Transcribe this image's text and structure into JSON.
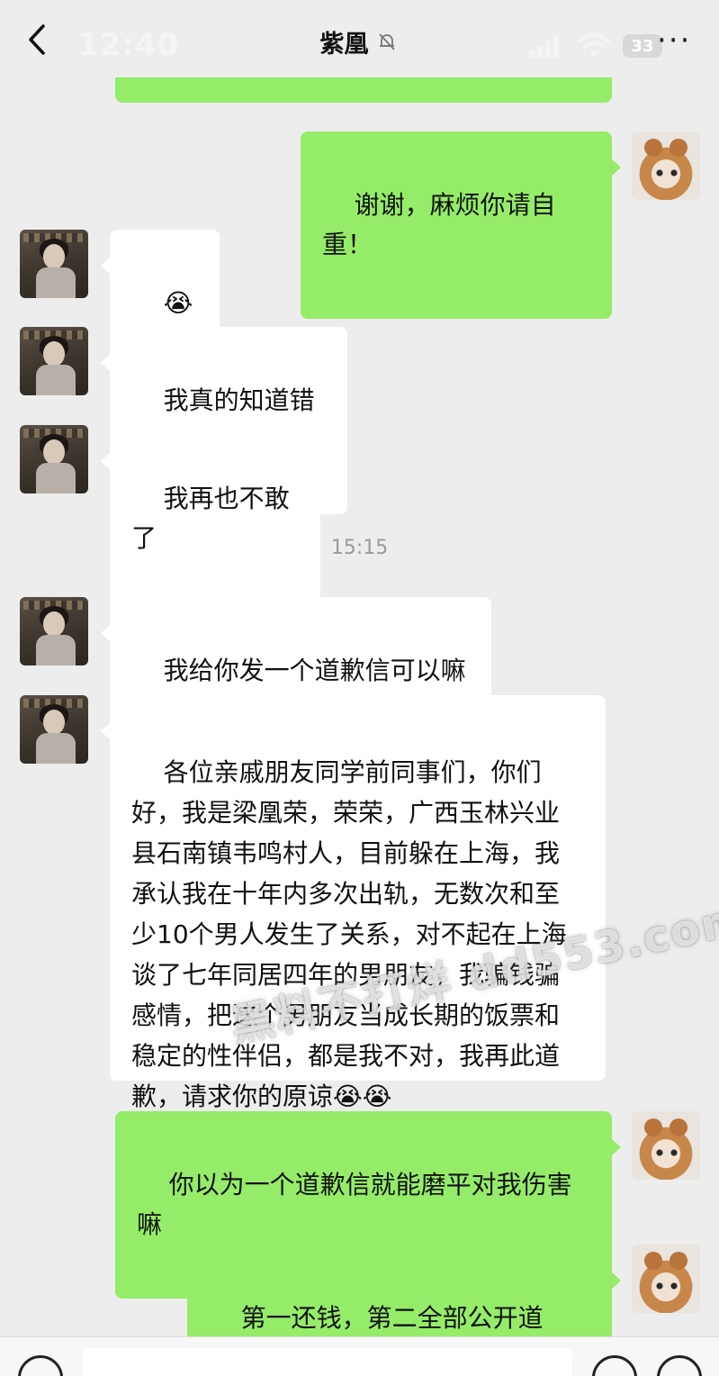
{
  "status_bar": {
    "time": "12:40",
    "battery": "33"
  },
  "header": {
    "title": "紫凰",
    "more_label": "···"
  },
  "icons": {
    "back": "chevron-left-icon",
    "mute": "bell-off-icon",
    "signal": "signal-icon",
    "wifi": "wifi-icon",
    "more": "ellipsis-icon",
    "voice": "voice-icon",
    "emoji": "emoji-icon",
    "plus": "plus-icon"
  },
  "colors": {
    "sent_bubble": "#95ec69",
    "received_bubble": "#ffffff",
    "background": "#ededed"
  },
  "messages": [
    {
      "id": "m0",
      "from": "me",
      "text": ""
    },
    {
      "id": "m1",
      "from": "me",
      "text": "谢谢，麻烦你请自重！"
    },
    {
      "id": "m2",
      "from": "her",
      "text": "😭😭"
    },
    {
      "id": "m3",
      "from": "her",
      "text": "我真的知道错了"
    },
    {
      "id": "m4",
      "from": "her",
      "text": "我再也不敢了"
    },
    {
      "id": "m5",
      "from": "her",
      "text": "我给你发一个道歉信可以嘛"
    },
    {
      "id": "m6",
      "from": "her",
      "text": "各位亲戚朋友同学前同事们，你们好，我是梁凰荣，荣荣，广西玉林兴业县石南镇韦鸣村人，目前躲在上海，我承认我在十年内多次出轨，无数次和至少10个男人发生了关系，对不起在上海谈了七年同居四年的男朋友，我骗钱骗感情，把这个男朋友当成长期的饭票和稳定的性伴侣，都是我不对，我再此道歉，请求你的原谅😭😭"
    },
    {
      "id": "m7",
      "from": "me",
      "text": "你以为一个道歉信就能磨平对我伤害嘛"
    },
    {
      "id": "m8",
      "from": "me",
      "text": "第一还钱，第二全部公开道歉！"
    }
  ],
  "timestamp": "15:15",
  "watermark": "黑料不打烊 dd553.com",
  "input": {
    "value": ""
  }
}
